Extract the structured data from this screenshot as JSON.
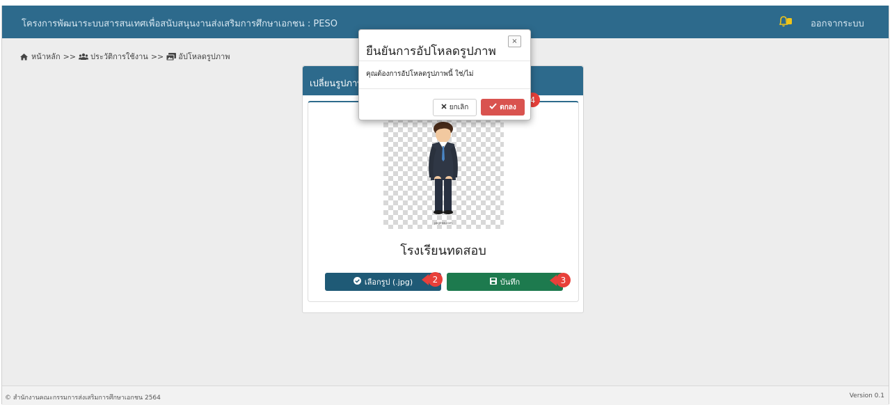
{
  "navbar": {
    "title": "โครงการพัฒนาระบบสารสนเทศเพื่อสนับสนุนงานส่งเสริมการศึกษาเอกชน : PESO",
    "logout_label": "ออกจากระบบ"
  },
  "breadcrumb": {
    "home": "หน้าหลัก",
    "sep1": ">>",
    "history": "ประวัติการใช้งาน",
    "sep2": ">>",
    "current": "อัปโหลดรูปภาพ"
  },
  "card": {
    "header": "เปลี่ยนรูปภาพ",
    "school_name": "โรงเรียนทดสอบ",
    "choose_label": "เลือกรูป (.jpg)",
    "save_label": "บันทึก",
    "avatar_caption": "pngtree.com"
  },
  "modal": {
    "title": "ยืนยันการอัปโหลดรูปภาพ",
    "close": "×",
    "body": "คุณต้องการอัปโหลดรูปภาพนี้ ใช่/ไม่",
    "cancel_label": "ยกเลิก",
    "ok_label": "ตกลง"
  },
  "badges": [
    "2",
    "3",
    "4"
  ],
  "footer": {
    "copyright": "© สำนักงานคณะกรรมการส่งเสริมการศึกษาเอกชน 2564",
    "version": "Version 0.1"
  },
  "colors": {
    "navbar": "#2d6a8c",
    "choose_button": "#1f5a76",
    "save_button": "#1d7a4e",
    "ok_button": "#d9534f",
    "badge": "#e8403a"
  }
}
